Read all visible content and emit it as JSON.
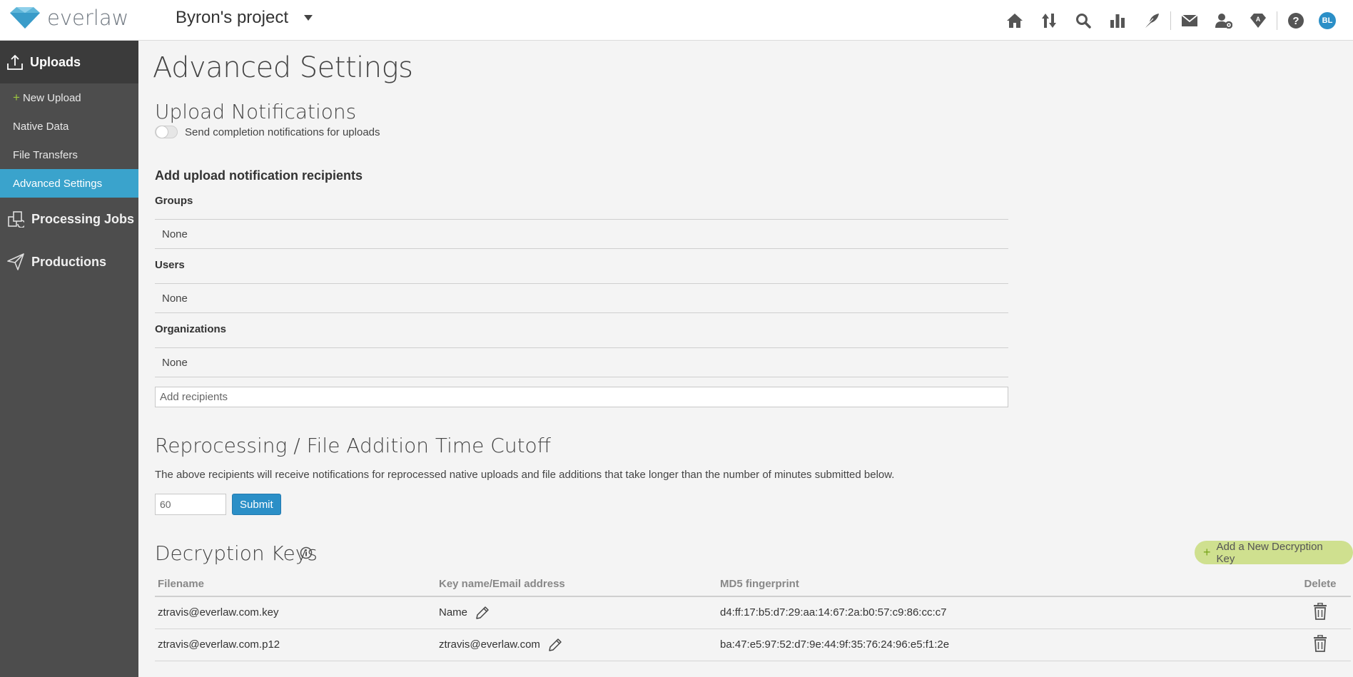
{
  "header": {
    "logo_text": "everlaw",
    "project_name": "Byron's project",
    "avatar_initials": "BL",
    "nav_icons": [
      "home-icon",
      "upload-download-icon",
      "search-icon",
      "analytics-icon",
      "storybuilder-icon",
      "messages-icon",
      "project-admin-icon",
      "legal-hold-icon",
      "help-icon"
    ]
  },
  "sidebar": {
    "uploads_label": "Uploads",
    "items": [
      {
        "label": "New Upload"
      },
      {
        "label": "Native Data"
      },
      {
        "label": "File Transfers"
      },
      {
        "label": "Advanced Settings"
      }
    ],
    "processing_jobs_label": "Processing Jobs",
    "productions_label": "Productions"
  },
  "main": {
    "title": "Advanced Settings",
    "upload_notifications": {
      "heading": "Upload Notifications",
      "toggle_label": "Send completion notifications for uploads",
      "toggle_on": false
    },
    "recipients": {
      "heading": "Add upload notification recipients",
      "groups_label": "Groups",
      "groups_value": "None",
      "users_label": "Users",
      "users_value": "None",
      "organizations_label": "Organizations",
      "organizations_value": "None",
      "add_placeholder": "Add recipients"
    },
    "cutoff": {
      "heading": "Reprocessing / File Addition Time Cutoff",
      "description": "The above recipients will receive notifications for reprocessed native uploads and file additions that take longer than the number of minutes submitted below.",
      "value": "60",
      "submit_label": "Submit"
    },
    "decryption": {
      "heading": "Decryption Keys",
      "add_label": "Add a New Decryption Key",
      "columns": {
        "filename": "Filename",
        "keyname": "Key name/Email address",
        "md5": "MD5 fingerprint",
        "delete": "Delete"
      },
      "rows": [
        {
          "filename": "ztravis@everlaw.com.key",
          "keyname": "Name",
          "md5": "d4:ff:17:b5:d7:29:aa:14:67:2a:b0:57:c9:86:cc:c7"
        },
        {
          "filename": "ztravis@everlaw.com.p12",
          "keyname": "ztravis@everlaw.com",
          "md5": "ba:47:e5:97:52:d7:9e:44:9f:35:76:24:96:e5:f1:2e"
        }
      ]
    }
  },
  "colors": {
    "accent": "#3aa3cc",
    "sidebar_bg": "#4d4d4d",
    "add_key_bg": "#cfe08f",
    "submit_bg": "#2b8fc7"
  }
}
